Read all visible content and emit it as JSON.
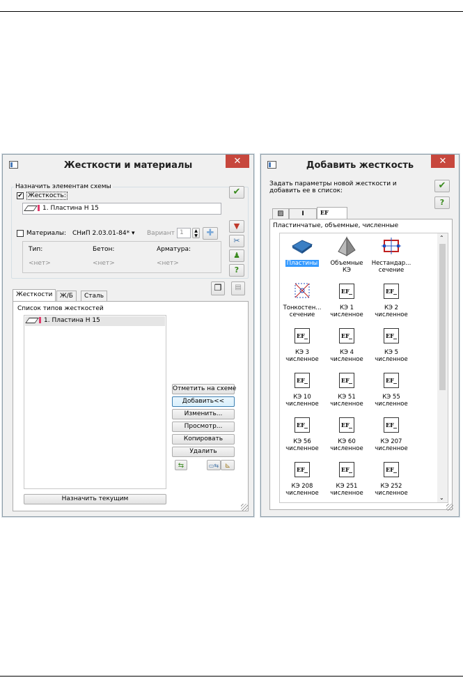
{
  "left_window": {
    "title": "Жесткости и материалы",
    "close_label": "✕",
    "assign_group_label": "Назначить элементам схемы",
    "stiffness_checkbox_label": "Жесткость:",
    "stiffness_value": "1. Пластина  Н 15",
    "materials_checkbox_label": "Материалы:",
    "materials_norm": "СНиП 2.03.01-84*",
    "variant_label": "Вариант",
    "variant_value": "1",
    "material_table": {
      "columns": [
        "Тип:",
        "Бетон:",
        "Арматура:"
      ],
      "values": [
        "<нет>",
        "<нет>",
        "<нет>"
      ]
    },
    "tabs": [
      "Жесткости",
      "Ж/Б",
      "Сталь"
    ],
    "list_header": "Список типов жесткостей",
    "list_items": [
      "1. Пластина  Н 15"
    ],
    "buttons": {
      "mark": "Отметить на схеме",
      "add": "Добавить<<",
      "edit": "Изменить...",
      "view": "Просмотр...",
      "copy": "Копировать",
      "delete": "Удалить",
      "assign_current": "Назначить текущим"
    },
    "help_label": "?"
  },
  "right_window": {
    "title": "Добавить жесткость",
    "close_label": "✕",
    "description": "Задать параметры новой жесткости и добавить ее в список:",
    "help_label": "?",
    "tabs": [
      "▨",
      "I",
      "EF"
    ],
    "group_label": "Пластинчатые, объемные, численные",
    "items": [
      {
        "line1": "Пластины",
        "line2": "",
        "selected": true,
        "icon": "plate-icon"
      },
      {
        "line1": "Объемные",
        "line2": "КЭ",
        "selected": false,
        "icon": "pyramid-icon"
      },
      {
        "line1": "Нестандар...",
        "line2": "сечение",
        "selected": false,
        "icon": "custom-section-icon"
      },
      {
        "line1": "Тонкостен...",
        "line2": "сечение",
        "selected": false,
        "icon": "thin-wall-icon"
      },
      {
        "line1": "КЭ 1",
        "line2": "численное",
        "selected": false,
        "icon": "ef-icon"
      },
      {
        "line1": "КЭ 2",
        "line2": "численное",
        "selected": false,
        "icon": "ef-icon"
      },
      {
        "line1": "КЭ 3",
        "line2": "численное",
        "selected": false,
        "icon": "ef-icon"
      },
      {
        "line1": "КЭ 4",
        "line2": "численное",
        "selected": false,
        "icon": "ef-icon"
      },
      {
        "line1": "КЭ 5",
        "line2": "численное",
        "selected": false,
        "icon": "ef-icon"
      },
      {
        "line1": "КЭ 10",
        "line2": "численное",
        "selected": false,
        "icon": "ef-icon"
      },
      {
        "line1": "КЭ 51",
        "line2": "численное",
        "selected": false,
        "icon": "ef-icon"
      },
      {
        "line1": "КЭ 55",
        "line2": "численное",
        "selected": false,
        "icon": "ef-icon"
      },
      {
        "line1": "КЭ 56",
        "line2": "численное",
        "selected": false,
        "icon": "ef-icon"
      },
      {
        "line1": "КЭ 60",
        "line2": "численное",
        "selected": false,
        "icon": "ef-icon"
      },
      {
        "line1": "КЭ 207",
        "line2": "численное",
        "selected": false,
        "icon": "ef-icon"
      },
      {
        "line1": "КЭ 208",
        "line2": "численное",
        "selected": false,
        "icon": "ef-icon"
      },
      {
        "line1": "КЭ 251",
        "line2": "численное",
        "selected": false,
        "icon": "ef-icon"
      },
      {
        "line1": "КЭ 252",
        "line2": "численное",
        "selected": false,
        "icon": "ef-icon"
      }
    ],
    "ef_icon_text": "EF"
  },
  "colors": {
    "accent_blue": "#3399ff",
    "close_red": "#c7473d",
    "pink_marker": "#e03c6c",
    "ok_green": "#3a8a1e"
  }
}
